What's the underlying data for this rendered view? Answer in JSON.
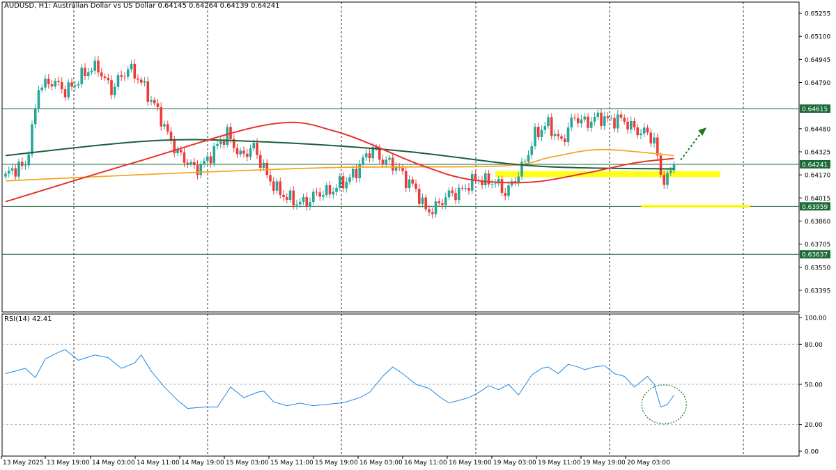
{
  "header": {
    "title": "AUDUSD, H1:  Australian Dollar vs US Dollar  0.64145 0.64264 0.64139 0.64241"
  },
  "rsi_panel": {
    "label": "RSI(14) 42.41"
  },
  "colors": {
    "bull": "#26a69a",
    "bear": "#ef3a3a",
    "ma_fast": "#e8322d",
    "ma_mid": "#f5a623",
    "ma_slow": "#1b5e3b",
    "hline": "#1e6b3a",
    "highlight": "#ffff00",
    "rsi": "#1e88e5",
    "arrow": "#1b7a1b"
  },
  "chart_data": [
    {
      "type": "candlestick",
      "title": "AUDUSD, H1:  Australian Dollar vs US Dollar  0.64145 0.64264 0.64139 0.64241",
      "ylim": [
        0.6325,
        0.6533
      ],
      "y_ticks": [
        "0.65255",
        "0.65100",
        "0.64945",
        "0.64790",
        "0.64480",
        "0.64325",
        "0.64170",
        "0.64015",
        "0.63860",
        "0.63705",
        "0.63550",
        "0.63395"
      ],
      "x_ticks": [
        "13 May 2025",
        "13 May 19:00",
        "14 May 03:00",
        "14 May 11:00",
        "14 May 19:00",
        "15 May 03:00",
        "15 May 11:00",
        "15 May 19:00",
        "16 May 03:00",
        "16 May 11:00",
        "16 May 19:00",
        "19 May 03:00",
        "19 May 11:00",
        "19 May 19:00",
        "20 May 03:00"
      ],
      "price_labels": [
        {
          "value": 0.64615,
          "label": "0.64615"
        },
        {
          "value": 0.64241,
          "label": "0.64241"
        },
        {
          "value": 0.63959,
          "label": "0.63959"
        },
        {
          "value": 0.63637,
          "label": "0.63637"
        }
      ],
      "last_price": 0.64241,
      "anchors": [
        [
          0,
          0.6416
        ],
        [
          6,
          0.6425
        ],
        [
          8,
          0.6446
        ],
        [
          10,
          0.6475
        ],
        [
          14,
          0.6481
        ],
        [
          18,
          0.6472
        ],
        [
          22,
          0.6482
        ],
        [
          28,
          0.649
        ],
        [
          32,
          0.6473
        ],
        [
          37,
          0.649
        ],
        [
          41,
          0.6478
        ],
        [
          45,
          0.6465
        ],
        [
          49,
          0.6443
        ],
        [
          53,
          0.643
        ],
        [
          57,
          0.642
        ],
        [
          63,
          0.6432
        ],
        [
          67,
          0.6446
        ],
        [
          71,
          0.6428
        ],
        [
          75,
          0.6437
        ],
        [
          79,
          0.6415
        ],
        [
          83,
          0.6406
        ],
        [
          87,
          0.6398
        ],
        [
          91,
          0.64
        ],
        [
          95,
          0.6404
        ],
        [
          99,
          0.6408
        ],
        [
          103,
          0.6412
        ],
        [
          107,
          0.6424
        ],
        [
          111,
          0.6434
        ],
        [
          115,
          0.6426
        ],
        [
          119,
          0.642
        ],
        [
          123,
          0.641
        ],
        [
          127,
          0.6393
        ],
        [
          131,
          0.6397
        ],
        [
          135,
          0.6405
        ],
        [
          139,
          0.6408
        ],
        [
          143,
          0.6415
        ],
        [
          147,
          0.6412
        ],
        [
          151,
          0.6406
        ],
        [
          156,
          0.642
        ],
        [
          160,
          0.6445
        ],
        [
          164,
          0.645
        ],
        [
          168,
          0.644
        ],
        [
          172,
          0.6455
        ],
        [
          176,
          0.6453
        ],
        [
          181,
          0.6455
        ],
        [
          185,
          0.6454
        ],
        [
          189,
          0.645
        ],
        [
          193,
          0.6445
        ],
        [
          196,
          0.644
        ],
        [
          198,
          0.6418
        ],
        [
          200,
          0.6414
        ],
        [
          202,
          0.6424
        ]
      ],
      "ma_fast": [
        [
          0,
          0.6399
        ],
        [
          40,
          0.6426
        ],
        [
          80,
          0.6451
        ],
        [
          100,
          0.6446
        ],
        [
          125,
          0.6424
        ],
        [
          140,
          0.6414
        ],
        [
          158,
          0.6412
        ],
        [
          175,
          0.6418
        ],
        [
          190,
          0.6425
        ],
        [
          202,
          0.6428
        ]
      ],
      "ma_mid": [
        [
          0,
          0.6413
        ],
        [
          50,
          0.6418
        ],
        [
          100,
          0.6422
        ],
        [
          150,
          0.6423
        ],
        [
          165,
          0.6429
        ],
        [
          180,
          0.6434
        ],
        [
          202,
          0.643
        ]
      ],
      "ma_slow": [
        [
          0,
          0.643
        ],
        [
          45,
          0.644
        ],
        [
          80,
          0.6439
        ],
        [
          120,
          0.6433
        ],
        [
          160,
          0.6423
        ],
        [
          202,
          0.6421
        ]
      ],
      "highlights": [
        {
          "from": 0.64155,
          "to": 0.64195,
          "x0": 148,
          "x1": 216
        },
        {
          "from": 0.6395,
          "to": 0.63968,
          "x0": 192,
          "x1": 225
        }
      ]
    },
    {
      "type": "line",
      "title": "RSI(14) 42.41",
      "ylim": [
        0,
        100
      ],
      "y_ticks": [
        "100.00",
        "80.00",
        "50.00",
        "20.00",
        "0.00"
      ],
      "levels": [
        80,
        50,
        20
      ],
      "series": [
        {
          "values": [
            [
              0,
              58
            ],
            [
              6,
              62
            ],
            [
              9,
              55
            ],
            [
              12,
              69
            ],
            [
              16,
              74
            ],
            [
              18,
              76
            ],
            [
              22,
              68
            ],
            [
              27,
              72
            ],
            [
              31,
              70
            ],
            [
              35,
              62
            ],
            [
              39,
              66
            ],
            [
              41,
              72
            ],
            [
              44,
              60
            ],
            [
              48,
              48
            ],
            [
              52,
              38
            ],
            [
              55,
              32
            ],
            [
              60,
              33
            ],
            [
              64,
              33
            ],
            [
              68,
              48
            ],
            [
              72,
              40
            ],
            [
              76,
              44
            ],
            [
              78,
              45
            ],
            [
              81,
              37
            ],
            [
              85,
              34
            ],
            [
              89,
              36
            ],
            [
              93,
              34
            ],
            [
              97,
              35
            ],
            [
              101,
              36
            ],
            [
              103,
              37
            ],
            [
              107,
              40
            ],
            [
              110,
              44
            ],
            [
              114,
              56
            ],
            [
              117,
              63
            ],
            [
              120,
              58
            ],
            [
              124,
              50
            ],
            [
              128,
              47
            ],
            [
              131,
              41
            ],
            [
              134,
              36
            ],
            [
              137,
              38
            ],
            [
              140,
              40
            ],
            [
              143,
              44
            ],
            [
              146,
              49
            ],
            [
              149,
              46
            ],
            [
              152,
              50
            ],
            [
              155,
              42
            ],
            [
              159,
              57
            ],
            [
              162,
              62
            ],
            [
              164,
              63
            ],
            [
              167,
              58
            ],
            [
              170,
              65
            ],
            [
              173,
              63
            ],
            [
              175,
              61
            ],
            [
              178,
              63
            ],
            [
              181,
              64
            ],
            [
              184,
              58
            ],
            [
              187,
              56
            ],
            [
              190,
              48
            ],
            [
              194,
              56
            ],
            [
              196,
              50
            ],
            [
              198,
              33
            ],
            [
              200,
              35
            ],
            [
              202,
              42
            ]
          ]
        }
      ]
    }
  ]
}
